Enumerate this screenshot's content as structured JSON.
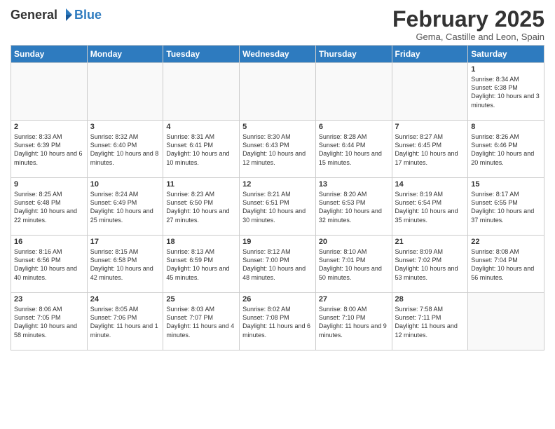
{
  "logo": {
    "general": "General",
    "blue": "Blue"
  },
  "title": "February 2025",
  "subtitle": "Gema, Castille and Leon, Spain",
  "days_header": [
    "Sunday",
    "Monday",
    "Tuesday",
    "Wednesday",
    "Thursday",
    "Friday",
    "Saturday"
  ],
  "weeks": [
    [
      {
        "num": "",
        "info": ""
      },
      {
        "num": "",
        "info": ""
      },
      {
        "num": "",
        "info": ""
      },
      {
        "num": "",
        "info": ""
      },
      {
        "num": "",
        "info": ""
      },
      {
        "num": "",
        "info": ""
      },
      {
        "num": "1",
        "info": "Sunrise: 8:34 AM\nSunset: 6:38 PM\nDaylight: 10 hours and 3 minutes."
      }
    ],
    [
      {
        "num": "2",
        "info": "Sunrise: 8:33 AM\nSunset: 6:39 PM\nDaylight: 10 hours and 6 minutes."
      },
      {
        "num": "3",
        "info": "Sunrise: 8:32 AM\nSunset: 6:40 PM\nDaylight: 10 hours and 8 minutes."
      },
      {
        "num": "4",
        "info": "Sunrise: 8:31 AM\nSunset: 6:41 PM\nDaylight: 10 hours and 10 minutes."
      },
      {
        "num": "5",
        "info": "Sunrise: 8:30 AM\nSunset: 6:43 PM\nDaylight: 10 hours and 12 minutes."
      },
      {
        "num": "6",
        "info": "Sunrise: 8:28 AM\nSunset: 6:44 PM\nDaylight: 10 hours and 15 minutes."
      },
      {
        "num": "7",
        "info": "Sunrise: 8:27 AM\nSunset: 6:45 PM\nDaylight: 10 hours and 17 minutes."
      },
      {
        "num": "8",
        "info": "Sunrise: 8:26 AM\nSunset: 6:46 PM\nDaylight: 10 hours and 20 minutes."
      }
    ],
    [
      {
        "num": "9",
        "info": "Sunrise: 8:25 AM\nSunset: 6:48 PM\nDaylight: 10 hours and 22 minutes."
      },
      {
        "num": "10",
        "info": "Sunrise: 8:24 AM\nSunset: 6:49 PM\nDaylight: 10 hours and 25 minutes."
      },
      {
        "num": "11",
        "info": "Sunrise: 8:23 AM\nSunset: 6:50 PM\nDaylight: 10 hours and 27 minutes."
      },
      {
        "num": "12",
        "info": "Sunrise: 8:21 AM\nSunset: 6:51 PM\nDaylight: 10 hours and 30 minutes."
      },
      {
        "num": "13",
        "info": "Sunrise: 8:20 AM\nSunset: 6:53 PM\nDaylight: 10 hours and 32 minutes."
      },
      {
        "num": "14",
        "info": "Sunrise: 8:19 AM\nSunset: 6:54 PM\nDaylight: 10 hours and 35 minutes."
      },
      {
        "num": "15",
        "info": "Sunrise: 8:17 AM\nSunset: 6:55 PM\nDaylight: 10 hours and 37 minutes."
      }
    ],
    [
      {
        "num": "16",
        "info": "Sunrise: 8:16 AM\nSunset: 6:56 PM\nDaylight: 10 hours and 40 minutes."
      },
      {
        "num": "17",
        "info": "Sunrise: 8:15 AM\nSunset: 6:58 PM\nDaylight: 10 hours and 42 minutes."
      },
      {
        "num": "18",
        "info": "Sunrise: 8:13 AM\nSunset: 6:59 PM\nDaylight: 10 hours and 45 minutes."
      },
      {
        "num": "19",
        "info": "Sunrise: 8:12 AM\nSunset: 7:00 PM\nDaylight: 10 hours and 48 minutes."
      },
      {
        "num": "20",
        "info": "Sunrise: 8:10 AM\nSunset: 7:01 PM\nDaylight: 10 hours and 50 minutes."
      },
      {
        "num": "21",
        "info": "Sunrise: 8:09 AM\nSunset: 7:02 PM\nDaylight: 10 hours and 53 minutes."
      },
      {
        "num": "22",
        "info": "Sunrise: 8:08 AM\nSunset: 7:04 PM\nDaylight: 10 hours and 56 minutes."
      }
    ],
    [
      {
        "num": "23",
        "info": "Sunrise: 8:06 AM\nSunset: 7:05 PM\nDaylight: 10 hours and 58 minutes."
      },
      {
        "num": "24",
        "info": "Sunrise: 8:05 AM\nSunset: 7:06 PM\nDaylight: 11 hours and 1 minute."
      },
      {
        "num": "25",
        "info": "Sunrise: 8:03 AM\nSunset: 7:07 PM\nDaylight: 11 hours and 4 minutes."
      },
      {
        "num": "26",
        "info": "Sunrise: 8:02 AM\nSunset: 7:08 PM\nDaylight: 11 hours and 6 minutes."
      },
      {
        "num": "27",
        "info": "Sunrise: 8:00 AM\nSunset: 7:10 PM\nDaylight: 11 hours and 9 minutes."
      },
      {
        "num": "28",
        "info": "Sunrise: 7:58 AM\nSunset: 7:11 PM\nDaylight: 11 hours and 12 minutes."
      },
      {
        "num": "",
        "info": ""
      }
    ]
  ]
}
